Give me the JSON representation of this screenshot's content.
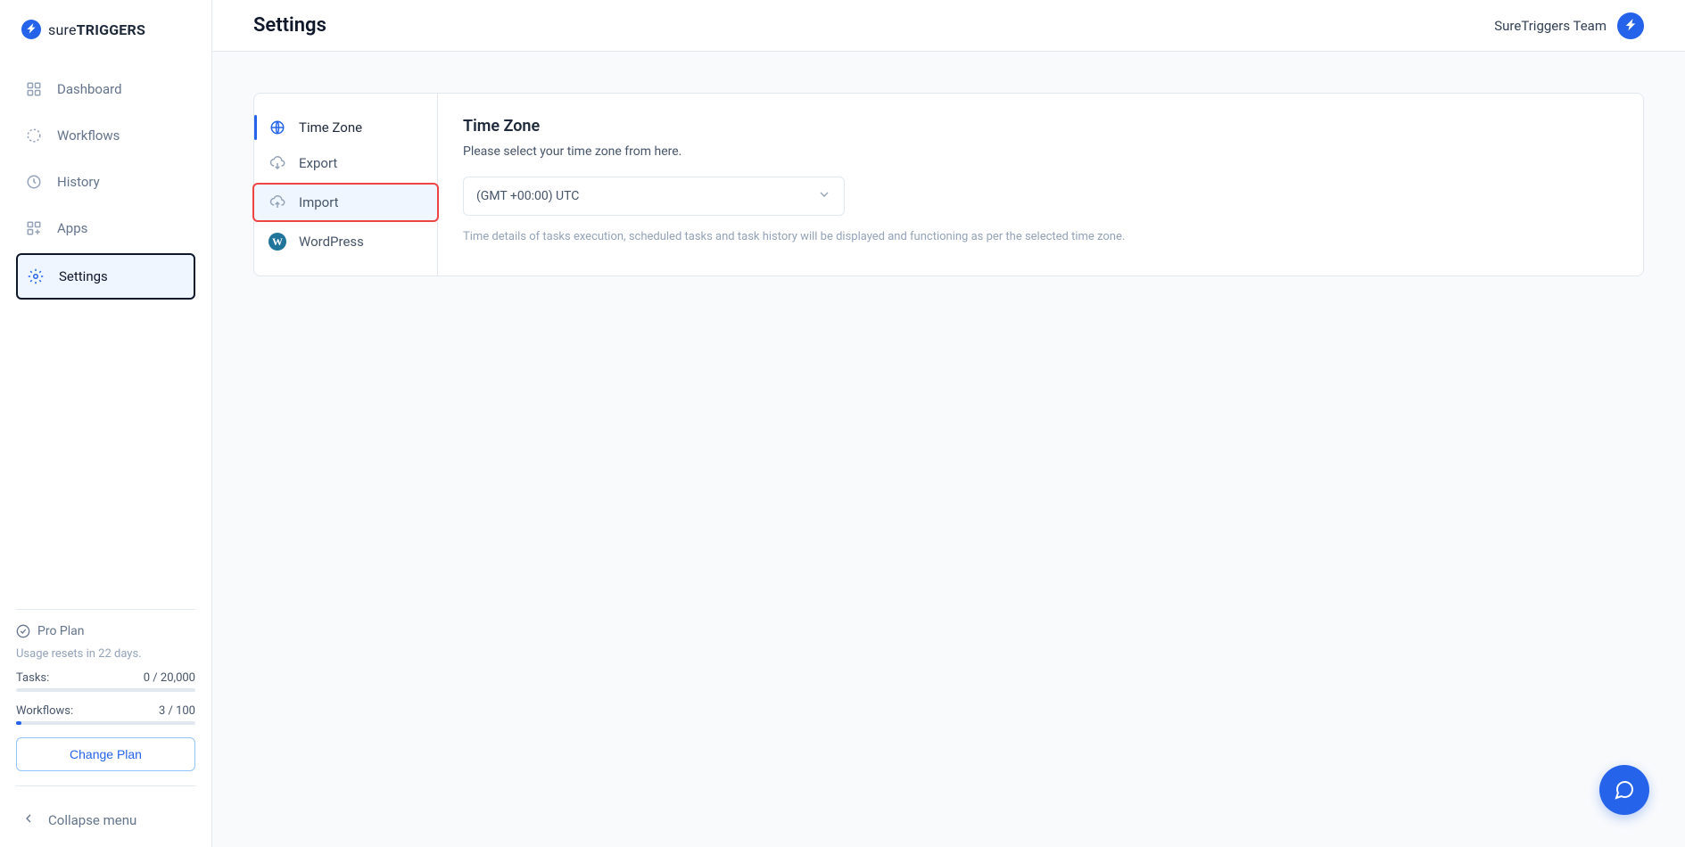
{
  "brand": {
    "prefix": "sure",
    "suffix": "TRIGGERS"
  },
  "sidebar": {
    "items": [
      {
        "label": "Dashboard"
      },
      {
        "label": "Workflows"
      },
      {
        "label": "History"
      },
      {
        "label": "Apps"
      },
      {
        "label": "Settings"
      }
    ],
    "plan": {
      "name": "Pro Plan",
      "resetText": "Usage resets in 22 days.",
      "tasksLabel": "Tasks:",
      "tasksValue": "0 / 20,000",
      "workflowsLabel": "Workflows:",
      "workflowsValue": "3 / 100",
      "changePlan": "Change Plan"
    },
    "collapse": "Collapse menu"
  },
  "header": {
    "title": "Settings",
    "teamName": "SureTriggers Team"
  },
  "settingsNav": [
    {
      "label": "Time Zone"
    },
    {
      "label": "Export"
    },
    {
      "label": "Import"
    },
    {
      "label": "WordPress"
    }
  ],
  "timezone": {
    "title": "Time Zone",
    "description": "Please select your time zone from here.",
    "selected": "(GMT +00:00) UTC",
    "helper": "Time details of tasks execution, scheduled tasks and task history will be displayed and functioning as per the selected time zone."
  }
}
